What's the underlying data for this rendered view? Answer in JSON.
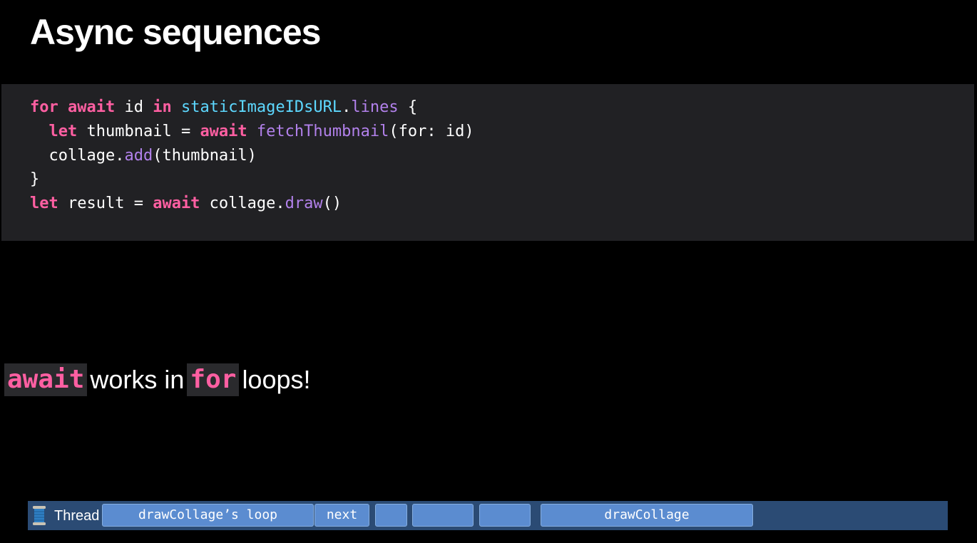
{
  "slide": {
    "title": "Async sequences"
  },
  "code": {
    "line1": {
      "kw_for": "for",
      "kw_await": "await",
      "plain_id": " id ",
      "kw_in": "in",
      "type_url": "staticImageIDsURL",
      "dot": ".",
      "member_lines": "lines",
      "brace": " {"
    },
    "line2": {
      "indent": "  ",
      "kw_let": "let",
      "plain_thumb": " thumbnail = ",
      "kw_await": "await",
      "fn_fetch": "fetchThumbnail",
      "args": "(for: id)"
    },
    "line3": {
      "indent": "  ",
      "plain_collage": "collage.",
      "fn_add": "add",
      "args": "(thumbnail)"
    },
    "line4": {
      "brace": "}"
    },
    "line5": {
      "kw_let": "let",
      "plain_result": " result = ",
      "kw_await": "await",
      "plain_collage": " collage.",
      "fn_draw": "draw",
      "args": "()"
    }
  },
  "caption": {
    "kw_await": "await",
    "text_works_in": "works in",
    "kw_for": "for",
    "text_loops": "loops!"
  },
  "timeline": {
    "thread_label": "Thread",
    "icon": "spool-of-thread-icon",
    "segments": [
      {
        "label": "drawCollage’s loop"
      },
      {
        "label": "next"
      },
      {
        "label": ""
      },
      {
        "label": ""
      },
      {
        "label": ""
      },
      {
        "label": "drawCollage"
      }
    ]
  },
  "colors": {
    "background": "#000000",
    "code_panel": "#212124",
    "keyword": "#ff5fa2",
    "type": "#5dd8ff",
    "function": "#b281eb",
    "timeline_bar": "#2b4b74",
    "timeline_segment": "#5b8cd0"
  }
}
